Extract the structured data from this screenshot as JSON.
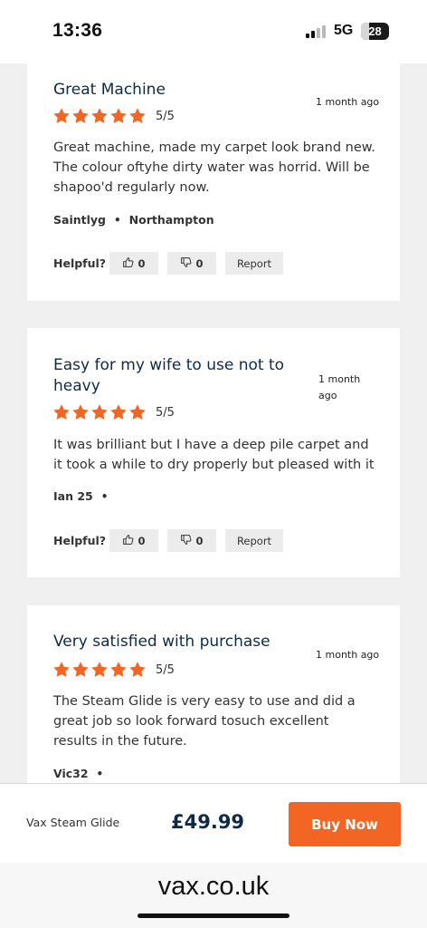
{
  "status": {
    "time": "13:36",
    "network": "5G",
    "battery": "28",
    "battery_level": 0.28
  },
  "colors": {
    "accent": "#f26522",
    "title": "#0e2a47",
    "star": "#f26522"
  },
  "reviews": [
    {
      "title": "Great Machine",
      "time": "1 month ago",
      "rating": 5,
      "score": "5/5",
      "body": "Great machine, made my carpet look brand new. The colour oftyhe dirty water was horrid. Will be shapoo'd regularly now.",
      "author": "Saintlyg",
      "location": "Northampton",
      "helpful_label": "Helpful?",
      "up_count": "0",
      "down_count": "0",
      "report_label": "Report"
    },
    {
      "title": "Easy for my wife to use not to heavy",
      "time": "1 month ago",
      "rating": 5,
      "score": "5/5",
      "body": "It was brilliant but I have a deep pile carpet and it took a while to dry properly but pleased with it",
      "author": "Ian 25",
      "location": "",
      "helpful_label": "Helpful?",
      "up_count": "0",
      "down_count": "0",
      "report_label": "Report"
    },
    {
      "title": "Very satisfied with purchase",
      "time": "1 month ago",
      "rating": 5,
      "score": "5/5",
      "body": "The Steam Glide is very easy to use and did a great job so look forward tosuch excellent results in the future.",
      "author": "Vic32",
      "location": ""
    }
  ],
  "product": {
    "name": "Vax Steam Glide",
    "price": "£49.99",
    "buy_label": "Buy Now"
  },
  "browser": {
    "url": "vax.co.uk"
  }
}
